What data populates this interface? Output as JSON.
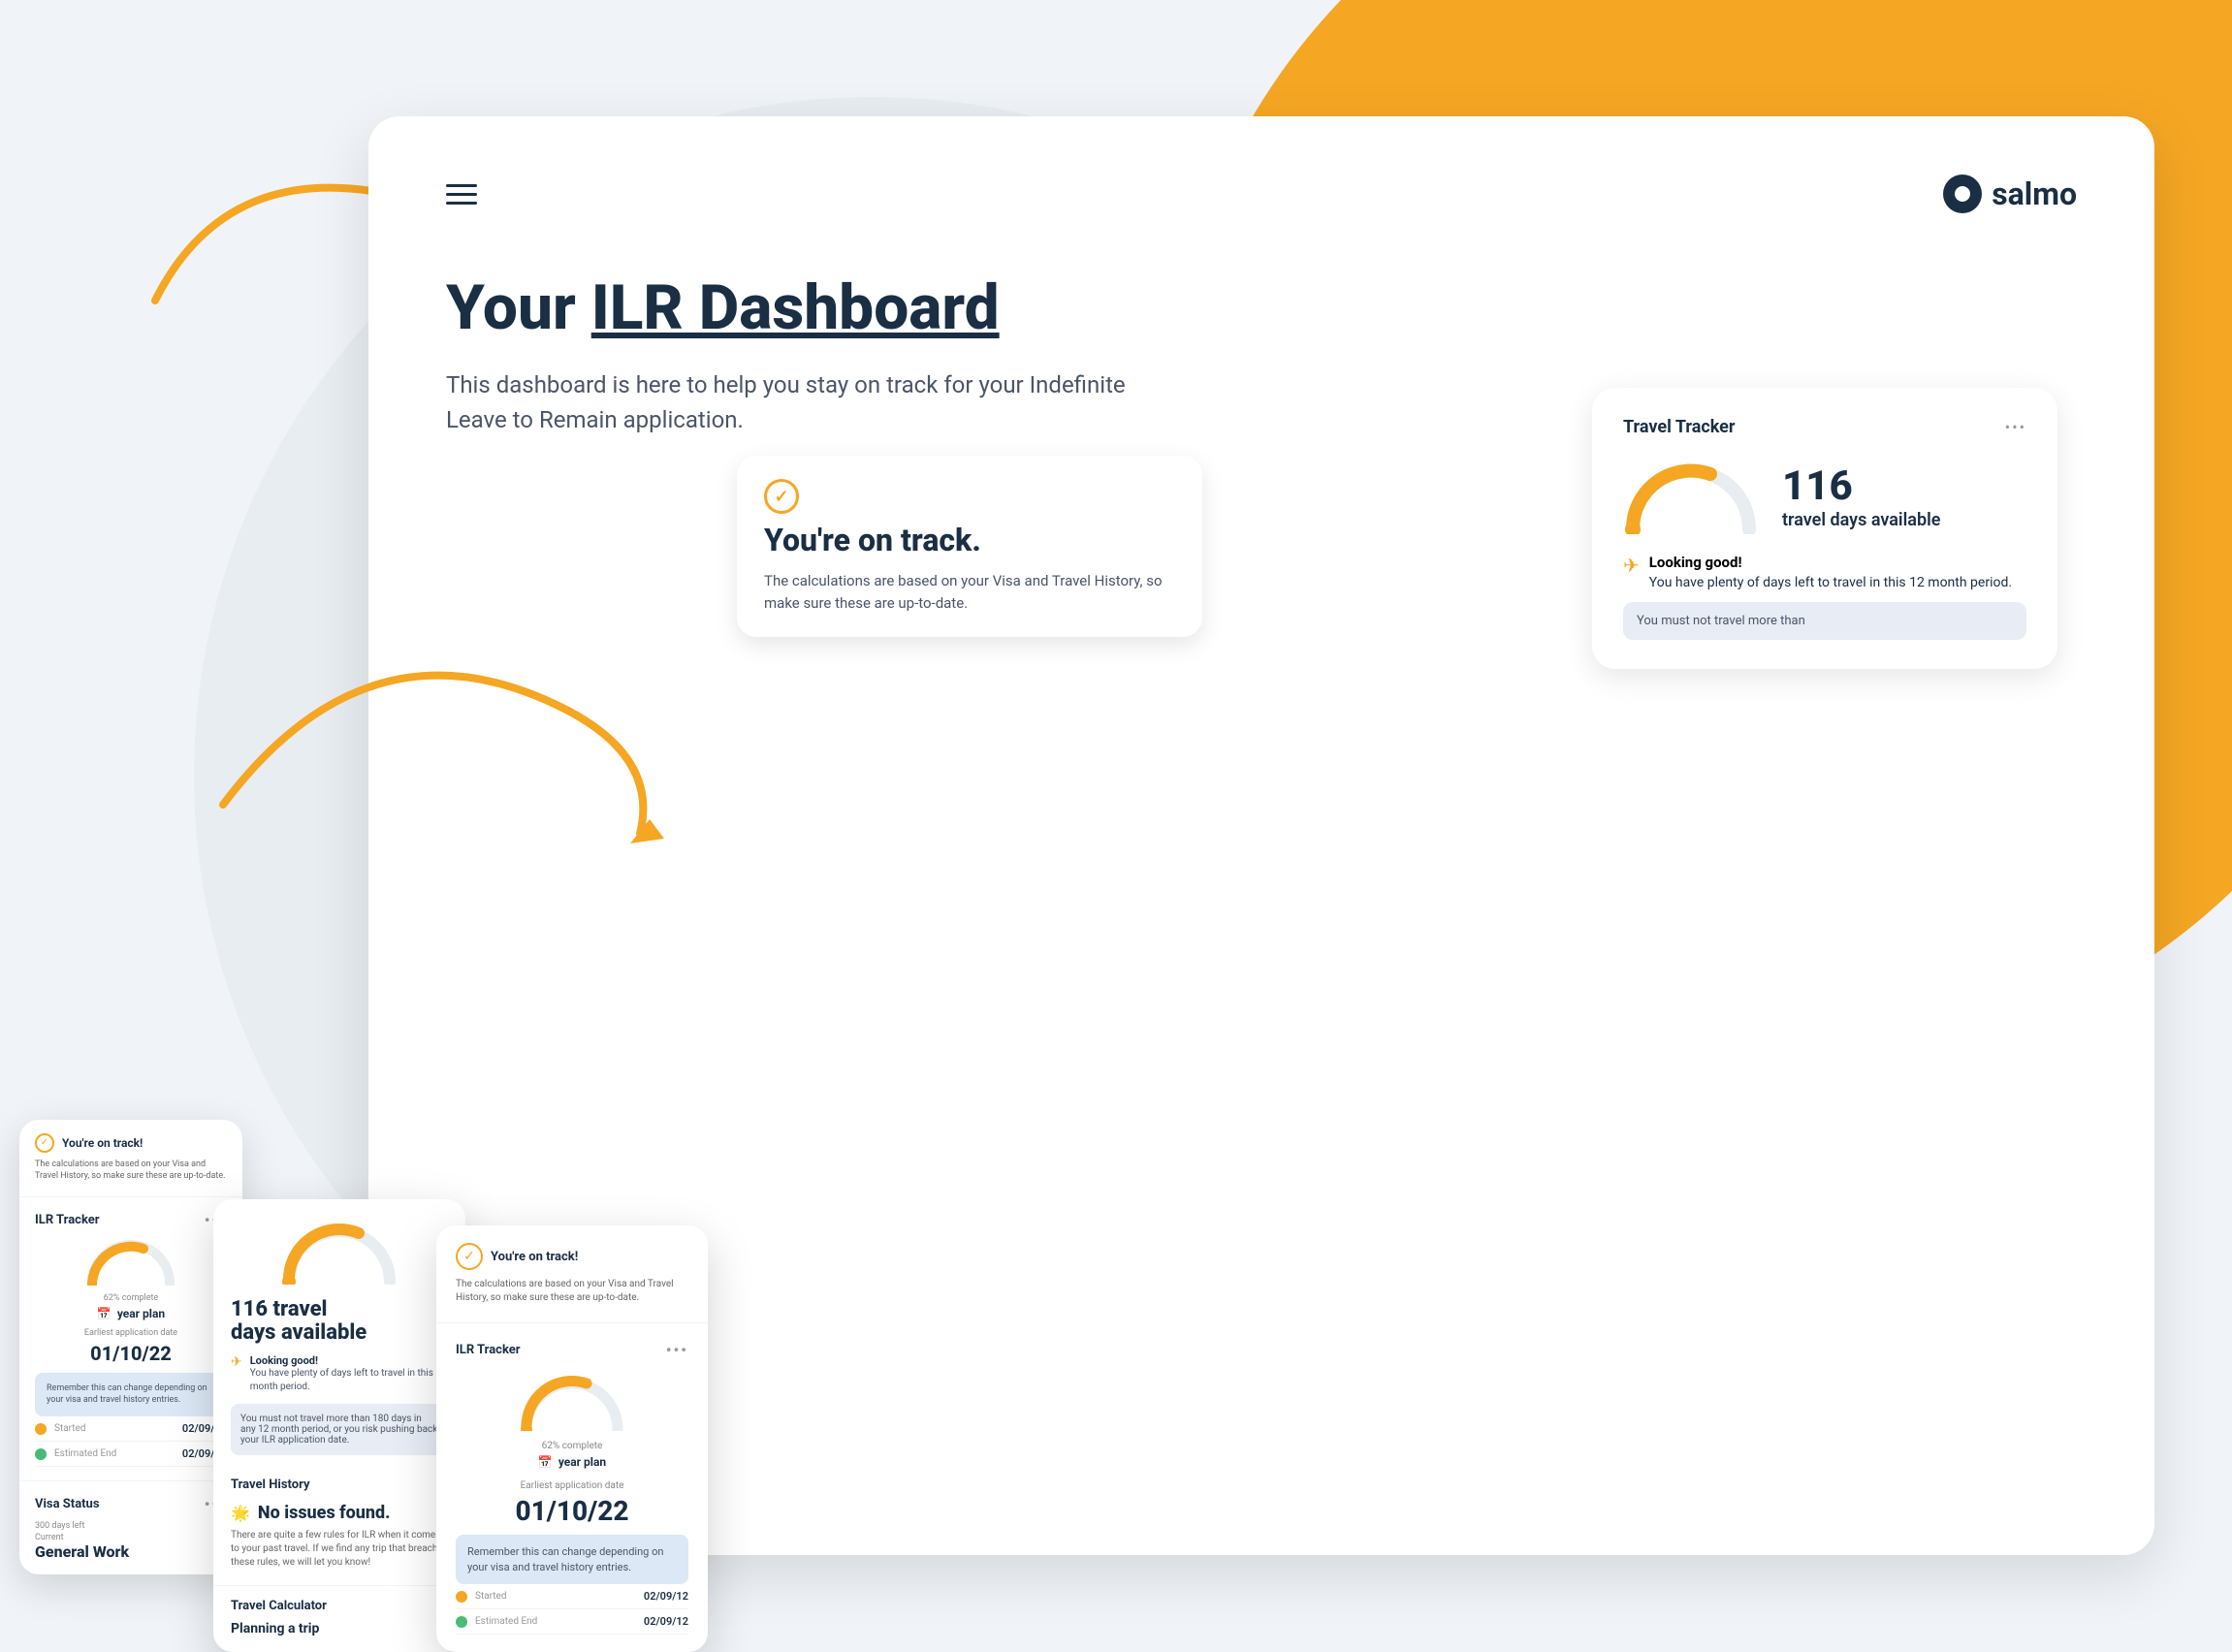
{
  "app": {
    "name": "salmo"
  },
  "header": {
    "menu_label": "menu",
    "logo_text": "salmo"
  },
  "hero": {
    "title_prefix": "Your ",
    "title_highlight": "ILR Dashboard",
    "subtitle": "This dashboard is here to help you stay on track for your Indefinite Leave to Remain application."
  },
  "travel_tracker_card": {
    "title": "Travel Tracker",
    "dots": "•••",
    "days_number": "116",
    "days_label": "travel days available",
    "looking_good_title": "Looking good!",
    "looking_good_text": "You have plenty of days left to travel in this 12 month period.",
    "warning_text": "You must not travel more than"
  },
  "ilr_tracker": {
    "title": "ILR Tracker",
    "dots": "•••",
    "percent": "62% complete",
    "year_plan": "year plan",
    "earliest_label": "Earliest application date",
    "earliest_date": "01/10/22",
    "note": "Remember this can change depending on your visa and travel history entries.",
    "started_label": "Started",
    "started_value": "02/09/12",
    "estimated_label": "Estimated End",
    "estimated_value": "02/09/12"
  },
  "on_track": {
    "title": "You're on track.",
    "desc1": "The calculations are based on your Visa and Travel History, so make sure these are up-to-date.",
    "status_text": "You're on track!",
    "status_sub": "The calculations are based on your Visa and Travel History, so make sure these are up-to-date."
  },
  "travel_history": {
    "title": "Travel History",
    "dots": "•",
    "no_issues": "No issues found.",
    "desc": "There are quite a few rules for ILR when it comes to your past travel. If we find any trip that breaches these rules, we will let you know!"
  },
  "visa_status": {
    "title": "Visa Status",
    "dots": "•••",
    "days_left": "300 days left",
    "current_label": "Current",
    "visa_type": "General Work"
  },
  "travel_calculator": {
    "title": "Travel Calculator",
    "dots": "••",
    "subtitle": "Planning a trip"
  },
  "colors": {
    "primary": "#1a2e44",
    "orange": "#f5a623",
    "light_blue": "#dce8f5",
    "bg": "#f0f4f8"
  }
}
